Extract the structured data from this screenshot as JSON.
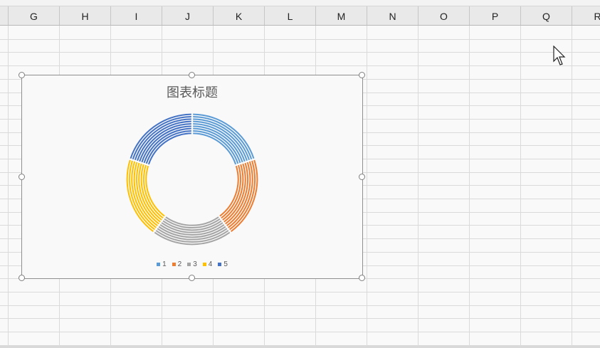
{
  "columns": [
    "G",
    "H",
    "I",
    "J",
    "K",
    "L",
    "M",
    "N",
    "O",
    "P",
    "Q",
    "R"
  ],
  "chart": {
    "title": "图表标题",
    "chart_data": {
      "type": "doughnut",
      "title": "图表标题",
      "categories": [
        "1",
        "2",
        "3",
        "4",
        "5"
      ],
      "series_count": 9,
      "values": [
        1,
        1,
        1,
        1,
        1
      ],
      "colors": [
        "#5b9bd5",
        "#ed7d31",
        "#a5a5a5",
        "#ffc000",
        "#4472c4"
      ],
      "legend": "bottom"
    }
  }
}
